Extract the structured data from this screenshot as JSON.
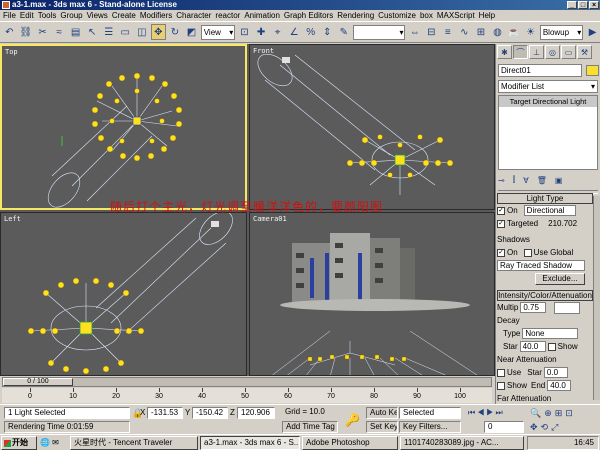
{
  "window": {
    "title": "a3-1.max - 3ds max 6 - Stand-alone License"
  },
  "menu": [
    "File",
    "Edit",
    "Tools",
    "Group",
    "Views",
    "Create",
    "Modifiers",
    "Character",
    "reactor",
    "Animation",
    "Graph Editors",
    "Rendering",
    "Customize",
    "box",
    "MAXScript",
    "Help"
  ],
  "toolbar": {
    "refcoord": "View",
    "render_type": "Blowup"
  },
  "viewports": {
    "top": "Top",
    "front": "Front",
    "left": "Left",
    "camera": "Camera01"
  },
  "overlay_note": "随后打个主光，灯光调至暖洋洋色的，要颜阳图",
  "command_panel": {
    "object_name": "Direct01",
    "modifier_list": "Modifier List",
    "stack_item": "Target Directional Light",
    "light_type": {
      "header": "Light Type",
      "on_label": "On",
      "type_value": "Directional",
      "targeted_label": "Targeted",
      "targeted_value": "210.702"
    },
    "shadows": {
      "header": "Shadows",
      "on_label": "On",
      "use_global_label": "Use Global",
      "shadow_type": "Ray Traced Shadow",
      "exclude_button": "Exclude..."
    },
    "intensity": {
      "header": "Intensity/Color/Attenuation",
      "multiplier_label": "Multip",
      "multiplier_value": "0.75",
      "decay_header": "Decay",
      "type_label": "Type",
      "type_value": "None",
      "start_label": "Star",
      "start_value": "40.0",
      "show_label": "Show",
      "near_header": "Near Attenuation",
      "use_label": "Use",
      "near_start_label": "Star",
      "near_start_value": "0.0",
      "near_show_label": "Show",
      "near_end_label": "End",
      "near_end_value": "40.0",
      "far_header": "Far Attenuation"
    }
  },
  "timeline": {
    "frame_label": "0 / 100",
    "ticks": [
      "0",
      "10",
      "20",
      "30",
      "40",
      "50",
      "60",
      "70",
      "80",
      "90",
      "100"
    ]
  },
  "status": {
    "selection": "1 Light Selected",
    "render_time": "Rendering Time  0:01:59",
    "x_label": "X",
    "x_value": "-131.53",
    "y_label": "Y",
    "y_value": "-150.42",
    "z_label": "Z",
    "z_value": "120.906",
    "grid": "Grid = 10.0",
    "add_time_tag": "Add Time Tag",
    "auto_key": "Auto Key",
    "auto_key_mode": "Selected",
    "set_key": "Set Key",
    "key_filters": "Key Filters...",
    "frame_field": "0"
  },
  "taskbar": {
    "start": "开始",
    "tasks": [
      "火星时代 - Tencent Traveler",
      "a3-1.max - 3ds max 6 - S...",
      "Adobe Photoshop",
      "1101740283089.jpg - AC..."
    ],
    "clock": "16:45"
  }
}
